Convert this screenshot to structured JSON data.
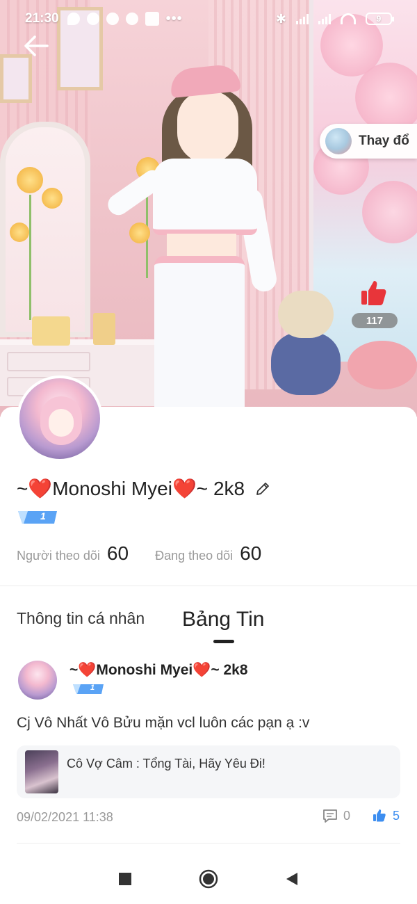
{
  "status_bar": {
    "time": "21:30",
    "icons": [
      "messenger-icon",
      "facebook-icon",
      "facebook-icon",
      "facebook-icon",
      "app-icon"
    ],
    "overflow": "•••",
    "battery": "9"
  },
  "hero": {
    "change_label": "Thay đổ",
    "like_count": "117"
  },
  "profile": {
    "name": "~❤️Monoshi Myei❤️~ 2k8",
    "level": "1",
    "followers_label": "Người theo dõi",
    "followers_count": "60",
    "following_label": "Đang theo dõi",
    "following_count": "60"
  },
  "tabs": [
    {
      "label": "Thông tin cá nhân",
      "active": false
    },
    {
      "label": "Bảng Tin",
      "active": true
    }
  ],
  "post": {
    "author": "~❤️Monoshi Myei❤️~ 2k8",
    "level": "1",
    "text": "Cj Vô Nhất Vô Bửu mặn vcl luôn các pạn ạ :v",
    "story_title": "Cô Vợ Câm : Tổng Tài, Hãy Yêu Đi!",
    "date": "09/02/2021 11:38",
    "comments": "0",
    "likes": "5"
  },
  "colors": {
    "accent_blue": "#3d8ef0",
    "like_red": "#e8353a",
    "badge_blue": "#5aa3f5"
  }
}
